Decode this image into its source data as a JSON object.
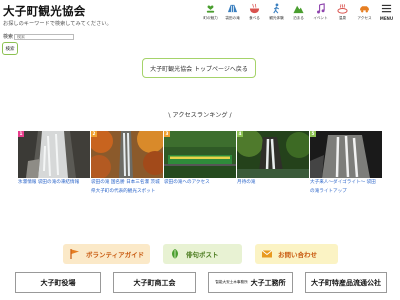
{
  "header": {
    "title": "大子町観光協会",
    "search_hint": "お探しのキーワードで検索してみてください。",
    "nav": [
      {
        "label": "町の魅力",
        "icon": "hand-heart-icon",
        "color": "#4a9e2f"
      },
      {
        "label": "袋田の滝",
        "icon": "waterfall-icon",
        "color": "#3a7fbf"
      },
      {
        "label": "食べる",
        "icon": "bowl-icon",
        "color": "#d9534f"
      },
      {
        "label": "観光体験",
        "icon": "walking-icon",
        "color": "#3a7fbf"
      },
      {
        "label": "泊まる",
        "icon": "mountain-icon",
        "color": "#4a9e2f"
      },
      {
        "label": "イベント",
        "icon": "music-note-icon",
        "color": "#8e44ad"
      },
      {
        "label": "温泉",
        "icon": "hot-spring-icon",
        "color": "#d9534f"
      },
      {
        "label": "アクセス",
        "icon": "car-icon",
        "color": "#e67e22"
      },
      {
        "label": "MENU",
        "icon": "hamburger-menu-icon",
        "color": "#333333"
      }
    ]
  },
  "search": {
    "label": "検索",
    "placeholder": "検索",
    "button_label": "検索"
  },
  "top_page_button": "大子町観光協会 トップページへ戻る",
  "ranking": {
    "heading": "\\ アクセスランキング /",
    "items": [
      {
        "rank": "1",
        "badge_color": "#e83e8c",
        "text": "氷瀑情報 袋田の滝の凍結情報"
      },
      {
        "rank": "2",
        "badge_color": "#f0a030",
        "text": "袋田の滝 国名勝 日本三名瀑 茨城県大子町の代表的観光スポット"
      },
      {
        "rank": "3",
        "badge_color": "#f0a030",
        "text": "袋田の滝へのアクセス"
      },
      {
        "rank": "4",
        "badge_color": "#8cc152",
        "text": "月待の滝"
      },
      {
        "rank": "5",
        "badge_color": "#8cc152",
        "text": "大子来人〜ダイゴライト〜 袋田の滝ライトアップ"
      }
    ]
  },
  "buttons": {
    "volunteer": "ボランティアガイド",
    "haiku": "俳句ポスト",
    "contact": "お問い合わせ"
  },
  "orgs": {
    "town_office": "大子町役場",
    "chamber": "大子町商工会",
    "kohmusho_small": "智能大安土木事務所",
    "kohmusho": "大子工務所",
    "products": "大子町特産品流通公社"
  },
  "colors": {
    "accent_green": "#8cc152",
    "link_blue": "#2a64c9",
    "orange_text": "#c8590f"
  }
}
